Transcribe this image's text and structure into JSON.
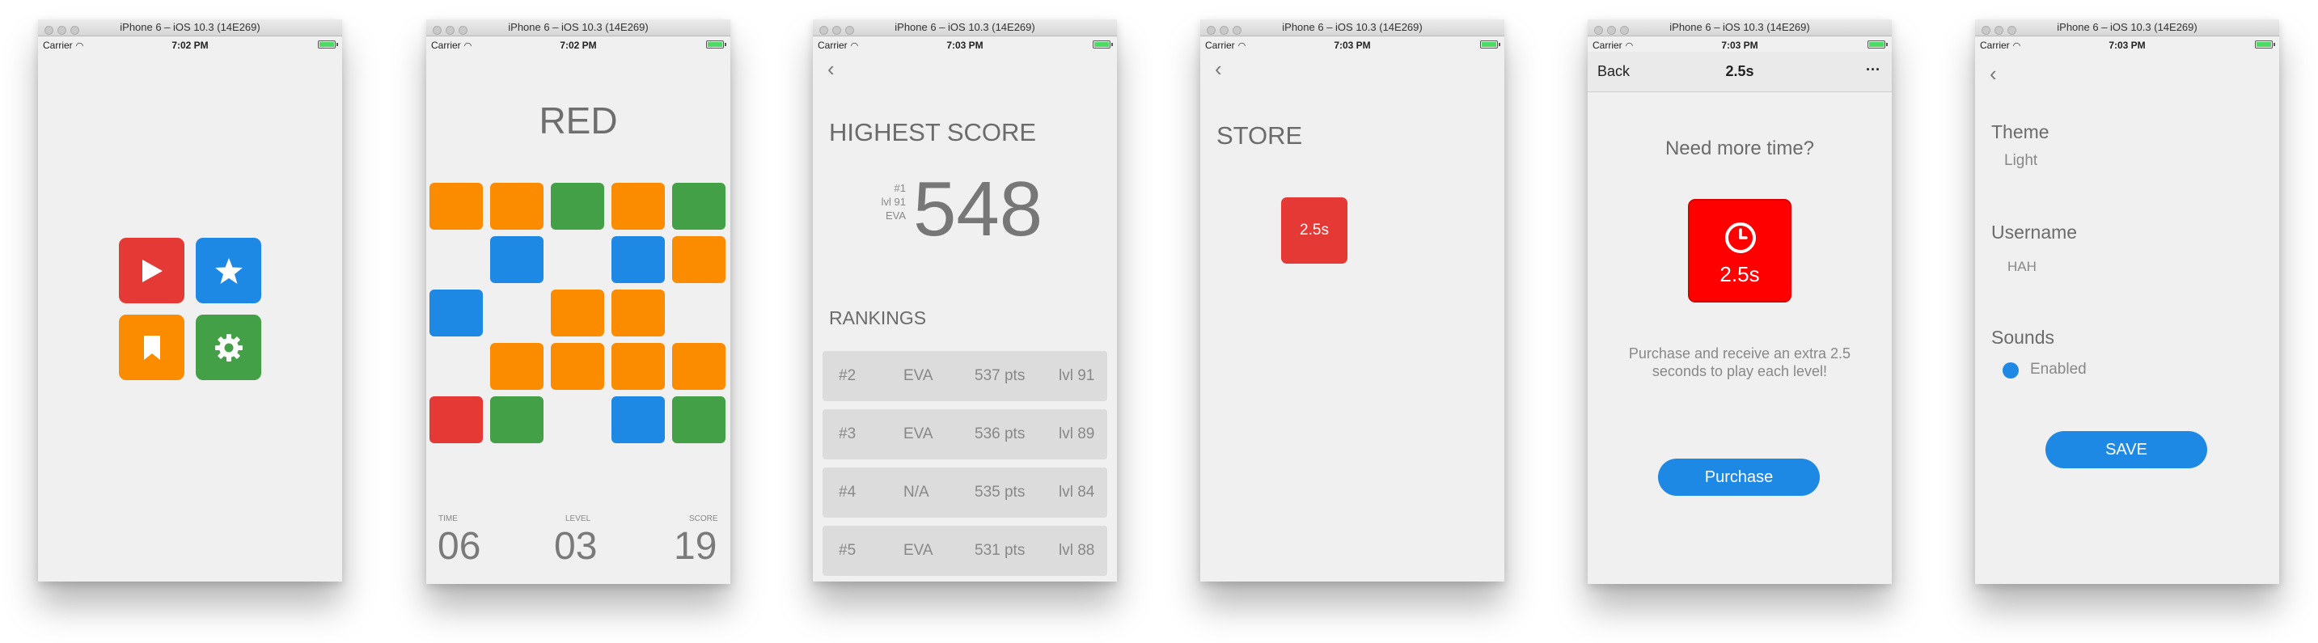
{
  "window_title": "iPhone 6 – iOS 10.3 (14E269)",
  "status": {
    "carrier": "Carrier",
    "times": [
      "7:02 PM",
      "7:02 PM",
      "7:03 PM",
      "7:03 PM",
      "7:03 PM",
      "7:03 PM"
    ]
  },
  "colors": {
    "red": "#e53935",
    "blue": "#1e88e5",
    "orange": "#fb8c00",
    "green": "#43a047",
    "bright_red": "#ff0000"
  },
  "menu": {
    "tiles": [
      {
        "icon": "play-icon",
        "color": "#e53935"
      },
      {
        "icon": "star-icon",
        "color": "#1e88e5"
      },
      {
        "icon": "bookmark-icon",
        "color": "#fb8c00"
      },
      {
        "icon": "gear-icon",
        "color": "#43a047"
      }
    ]
  },
  "game": {
    "word": "RED",
    "grid": [
      [
        "orange",
        "orange",
        "green",
        "orange",
        "green"
      ],
      [
        "",
        "blue",
        "",
        "blue",
        "orange"
      ],
      [
        "blue",
        "",
        "orange",
        "orange",
        ""
      ],
      [
        "",
        "orange",
        "orange",
        "orange",
        "orange"
      ],
      [
        "red",
        "green",
        "",
        "blue",
        "green"
      ]
    ],
    "time_label": "TIME",
    "time": "06",
    "level_label": "LEVEL",
    "level": "03",
    "score_label": "SCORE",
    "score": "19"
  },
  "scores": {
    "back": "‹",
    "title": "HIGHEST SCORE",
    "top_rank": "#1",
    "top_level": "lvl 91",
    "top_name": "EVA",
    "top_score": "548",
    "rankings_title": "RANKINGS",
    "rows": [
      {
        "rank": "#2",
        "name": "EVA",
        "pts": "537 pts",
        "lvl": "lvl 91"
      },
      {
        "rank": "#3",
        "name": "EVA",
        "pts": "536 pts",
        "lvl": "lvl 89"
      },
      {
        "rank": "#4",
        "name": "N/A",
        "pts": "535 pts",
        "lvl": "lvl 84"
      },
      {
        "rank": "#5",
        "name": "EVA",
        "pts": "531 pts",
        "lvl": "lvl 88"
      }
    ]
  },
  "store": {
    "back": "‹",
    "title": "STORE",
    "item_label": "2.5s"
  },
  "purchase": {
    "back_label": "Back",
    "nav_title": "2.5s",
    "more": "···",
    "question": "Need more time?",
    "item_label": "2.5s",
    "description_line1": "Purchase and receive an extra 2.5",
    "description_line2": "seconds to play each level!",
    "button": "Purchase"
  },
  "settings": {
    "back": "‹",
    "theme_label": "Theme",
    "theme_value": "Light",
    "username_label": "Username",
    "username_value": "HAH",
    "sounds_label": "Sounds",
    "sounds_value": "Enabled",
    "save_button": "SAVE"
  }
}
